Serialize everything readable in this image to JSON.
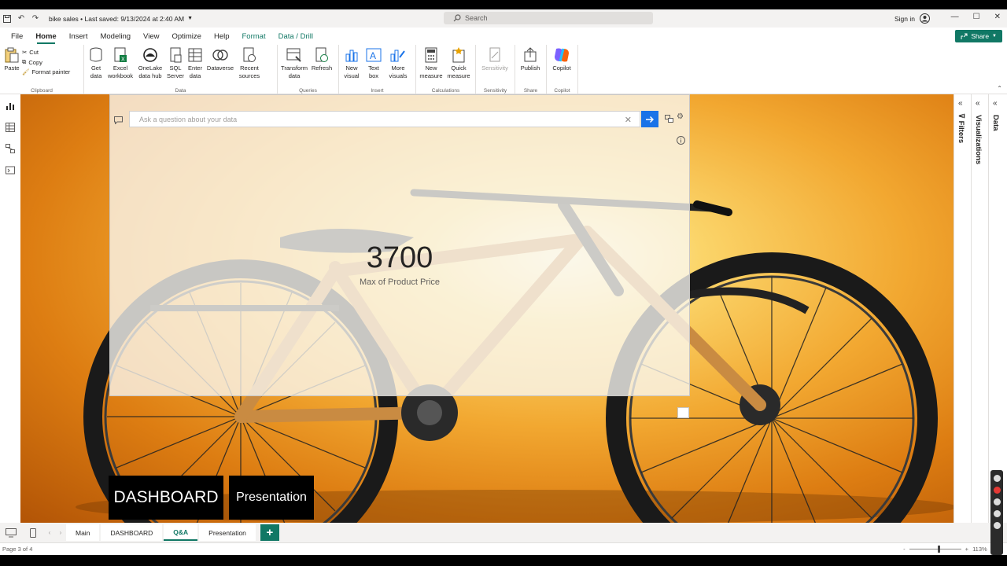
{
  "titlebar": {
    "file_title": "bike sales • Last saved: 9/13/2024 at 2:40 AM",
    "search_placeholder": "Search",
    "sign_in": "Sign in"
  },
  "menu": {
    "tabs": [
      "File",
      "Home",
      "Insert",
      "Modeling",
      "View",
      "Optimize",
      "Help",
      "Format",
      "Data / Drill"
    ],
    "active": "Home",
    "share": "Share"
  },
  "ribbon": {
    "clipboard": {
      "paste": "Paste",
      "cut": "Cut",
      "copy": "Copy",
      "format_painter": "Format painter",
      "label": "Clipboard"
    },
    "data": {
      "get_data": "Get data",
      "excel": "Excel workbook",
      "onelake": "OneLake data hub",
      "sql": "SQL Server",
      "enter": "Enter data",
      "dataverse": "Dataverse",
      "recent": "Recent sources",
      "label": "Data"
    },
    "queries": {
      "transform": "Transform data",
      "refresh": "Refresh",
      "label": "Queries"
    },
    "insert": {
      "new_visual": "New visual",
      "text_box": "Text box",
      "more_visuals": "More visuals",
      "label": "Insert"
    },
    "calculations": {
      "new_measure": "New measure",
      "quick_measure": "Quick measure",
      "label": "Calculations"
    },
    "sensitivity": {
      "sensitivity": "Sensitivity",
      "label": "Sensitivity"
    },
    "share": {
      "publish": "Publish",
      "label": "Share"
    },
    "copilot": {
      "copilot": "Copilot",
      "label": "Copilot"
    }
  },
  "qa": {
    "placeholder": "Ask a question about your data",
    "value": "3700",
    "label": "Max of Product Price"
  },
  "buttons": {
    "dashboard": "DASHBOARD",
    "presentation": "Presentation"
  },
  "panes": {
    "filters": "Filters",
    "visualizations": "Visualizations",
    "data": "Data"
  },
  "pages": {
    "tabs": [
      "Main",
      "DASHBOARD",
      "Q&A",
      "Presentation"
    ],
    "active": "Q&A",
    "add": "+"
  },
  "status": {
    "page_indicator": "Page 3 of 4",
    "zoom": "113%",
    "zoom_level": 0.55
  },
  "colors": {
    "accent": "#117865",
    "submit": "#1a73e8",
    "canvas_orange": "#f2a831"
  }
}
